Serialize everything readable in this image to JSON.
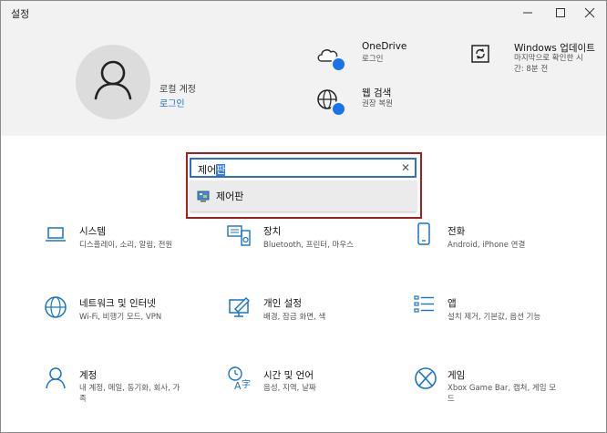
{
  "window": {
    "title": "설정"
  },
  "account": {
    "type": "로컬 계정",
    "login": "로그인"
  },
  "onedrive": {
    "title": "OneDrive",
    "sub": "로그인"
  },
  "web_search": {
    "title": "웹 검색",
    "sub": "권장 복원"
  },
  "windows_update": {
    "title": "Windows 업데이트",
    "sub1": "마지막으로 확인한 시",
    "sub2": "간: 8분 전"
  },
  "search": {
    "text_before": "제어",
    "text_selected": "판",
    "clear": "✕"
  },
  "suggestion": {
    "label": "제어판"
  },
  "categories": [
    {
      "title": "시스템",
      "sub": "디스플레이, 소리, 알림, 전원"
    },
    {
      "title": "장치",
      "sub": "Bluetooth, 프린터, 마우스"
    },
    {
      "title": "전화",
      "sub": "Android, iPhone 연결"
    },
    {
      "title": "네트워크 및 인터넷",
      "sub": "Wi-Fi, 비행기 모드, VPN"
    },
    {
      "title": "개인 설정",
      "sub": "배경, 잠금 화면, 색"
    },
    {
      "title": "앱",
      "sub": "설치 제거, 기본값, 옵션 기능"
    },
    {
      "title": "계정",
      "sub1": "내 계정, 메일, 동기화, 회사, 가",
      "sub2": "족"
    },
    {
      "title": "시간 및 언어",
      "sub": "음성, 지역, 날짜"
    },
    {
      "title": "게임",
      "sub1": "Xbox Game Bar, 캡처, 게임 모",
      "sub2": "드"
    }
  ],
  "colors": {
    "accent": "#1a73c7",
    "header_bg": "#f2f2f2",
    "highlight_outline": "#a81c1c"
  }
}
